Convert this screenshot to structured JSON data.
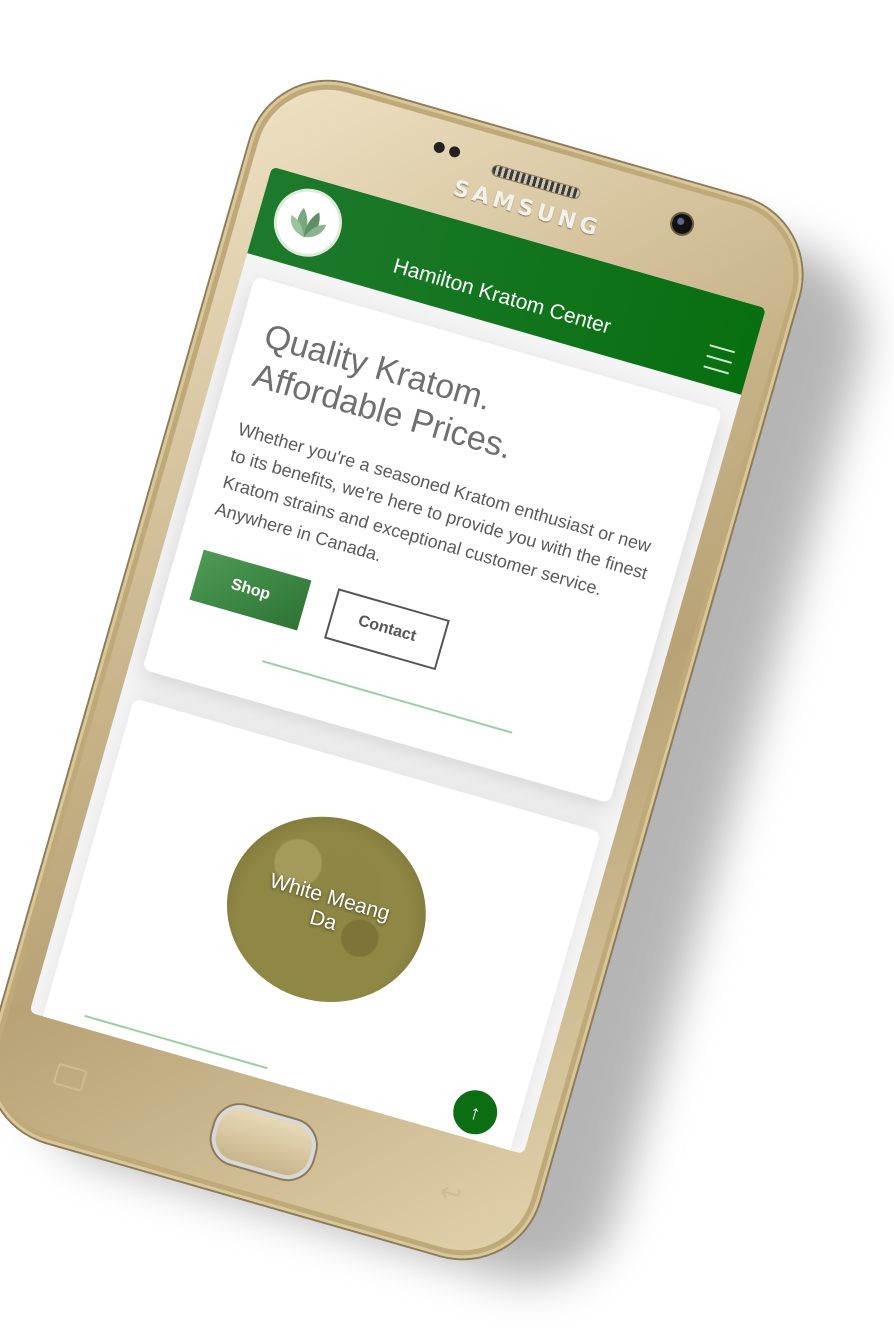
{
  "device": {
    "brand": "SAMSUNG"
  },
  "site": {
    "title": "Hamilton Kratom Center"
  },
  "hero": {
    "title_line1": "Quality Kratom.",
    "title_line2": "Affordable Prices.",
    "text": "Whether you're a seasoned Kratom enthusiast or new to its benefits, we're here to provide you with the finest Kratom strains and exceptional customer service. Anywhere in Canada.",
    "shop_label": "Shop",
    "contact_label": "Contact"
  },
  "product": {
    "name_line1": "White Meang",
    "name_line2": "Da"
  },
  "scroll_top_icon": "↑",
  "colors": {
    "header": "#086f10",
    "accent": "#2e7435",
    "divider": "#9bcf9f"
  },
  "icons": [
    "leaf-logo-icon",
    "hamburger-menu-icon",
    "arrow-up-icon"
  ]
}
